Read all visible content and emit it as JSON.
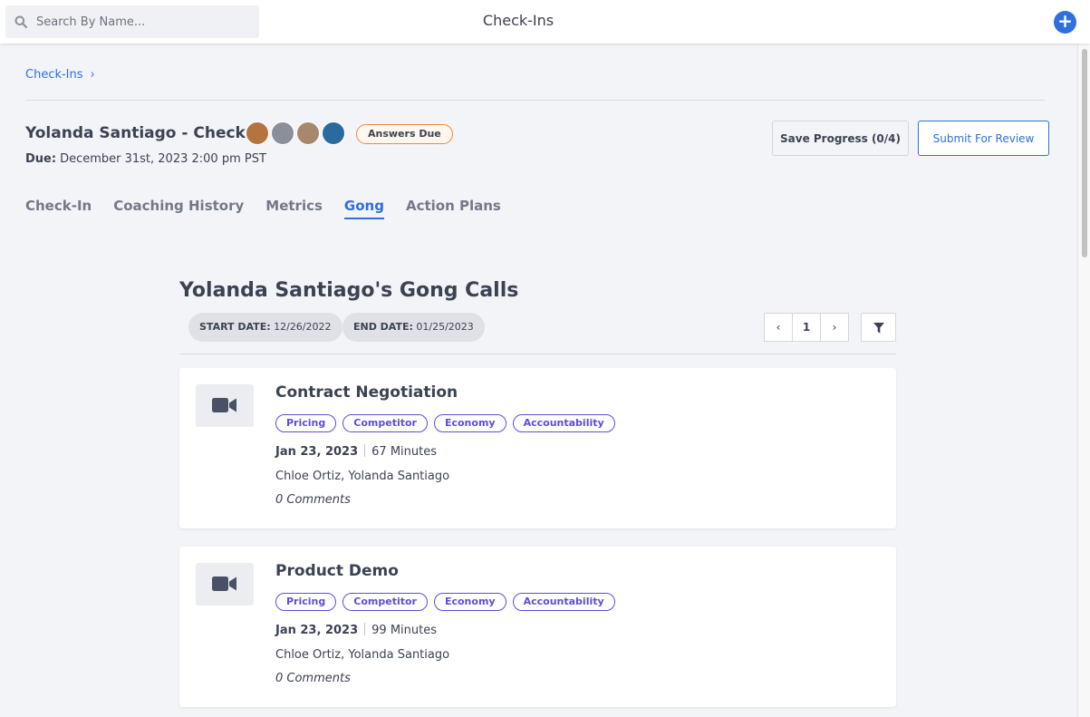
{
  "topbar": {
    "search_placeholder": "Search By Name...",
    "title": "Check-Ins",
    "add_label": "+"
  },
  "breadcrumb": {
    "item": "Check-Ins",
    "chevron": "›"
  },
  "header": {
    "title": "Yolanda Santiago - Check-In",
    "badge": "Answers Due",
    "due_label": "Due:",
    "due_value": "December 31st, 2023 2:00 pm PST",
    "avatar_colors": [
      "#b5743e",
      "#8a8f99",
      "#a6896c",
      "#2b6a9e"
    ]
  },
  "actions": {
    "save": "Save Progress (0/4)",
    "submit": "Submit For Review"
  },
  "tabs": [
    {
      "label": "Check-In",
      "active": false
    },
    {
      "label": "Coaching History",
      "active": false
    },
    {
      "label": "Metrics",
      "active": false
    },
    {
      "label": "Gong",
      "active": true
    },
    {
      "label": "Action Plans",
      "active": false
    }
  ],
  "gong": {
    "title": "Yolanda Santiago's Gong Calls",
    "start_label": "START DATE:",
    "start_value": "12/26/2022",
    "end_label": "END DATE:",
    "end_value": "01/25/2023",
    "pager": {
      "prev": "‹",
      "page": "1",
      "next": "›"
    },
    "calls": [
      {
        "title": "Contract Negotiation",
        "tags": [
          "Pricing",
          "Competitor",
          "Economy",
          "Accountability"
        ],
        "date": "Jan 23, 2023",
        "duration": "67 Minutes",
        "people": "Chloe Ortiz, Yolanda Santiago",
        "comments": "0 Comments"
      },
      {
        "title": "Product Demo",
        "tags": [
          "Pricing",
          "Competitor",
          "Economy",
          "Accountability"
        ],
        "date": "Jan 23, 2023",
        "duration": "99 Minutes",
        "people": "Chloe Ortiz, Yolanda Santiago",
        "comments": "0 Comments"
      }
    ]
  },
  "colors": {
    "accent": "#2f6fde",
    "tag": "#5b4fd8",
    "badge_border": "#f08a3e"
  }
}
